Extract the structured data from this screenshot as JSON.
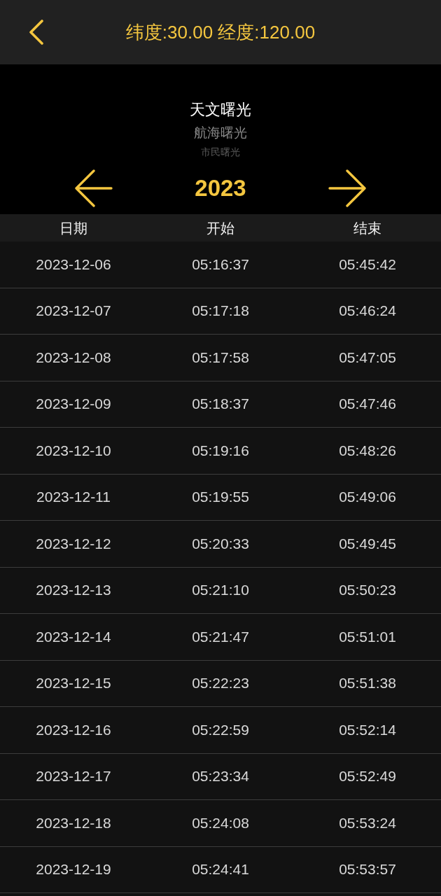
{
  "header": {
    "title": "纬度:30.00 经度:120.00"
  },
  "picker": {
    "items": [
      {
        "label": "天文曙光",
        "selected": true
      },
      {
        "label": "航海曙光",
        "selected": false
      },
      {
        "label": "市民曙光",
        "selected": false
      }
    ]
  },
  "year_nav": {
    "year": "2023"
  },
  "table": {
    "columns": [
      "日期",
      "开始",
      "结束"
    ],
    "rows": [
      [
        "2023-12-06",
        "05:16:37",
        "05:45:42"
      ],
      [
        "2023-12-07",
        "05:17:18",
        "05:46:24"
      ],
      [
        "2023-12-08",
        "05:17:58",
        "05:47:05"
      ],
      [
        "2023-12-09",
        "05:18:37",
        "05:47:46"
      ],
      [
        "2023-12-10",
        "05:19:16",
        "05:48:26"
      ],
      [
        "2023-12-11",
        "05:19:55",
        "05:49:06"
      ],
      [
        "2023-12-12",
        "05:20:33",
        "05:49:45"
      ],
      [
        "2023-12-13",
        "05:21:10",
        "05:50:23"
      ],
      [
        "2023-12-14",
        "05:21:47",
        "05:51:01"
      ],
      [
        "2023-12-15",
        "05:22:23",
        "05:51:38"
      ],
      [
        "2023-12-16",
        "05:22:59",
        "05:52:14"
      ],
      [
        "2023-12-17",
        "05:23:34",
        "05:52:49"
      ],
      [
        "2023-12-18",
        "05:24:08",
        "05:53:24"
      ],
      [
        "2023-12-19",
        "05:24:41",
        "05:53:57"
      ]
    ]
  }
}
